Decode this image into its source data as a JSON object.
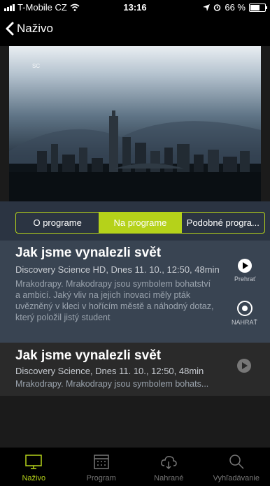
{
  "status": {
    "carrier": "T-Mobile CZ",
    "time": "13:16",
    "battery": "66 %"
  },
  "nav": {
    "back_label": "Naživo"
  },
  "hero": {
    "logo_text": "SC"
  },
  "tabs": [
    {
      "label": "O programe"
    },
    {
      "label": "Na programe"
    },
    {
      "label": "Podobné progra..."
    }
  ],
  "program1": {
    "title": "Jak jsme vynalezli svět",
    "meta": "Discovery Science HD, Dnes 11. 10., 12:50, 48min",
    "description": "Mrakodrapy. Mrakodrapy jsou symbolem bohatství a ambicí. Jaký vliv na jejich inovaci měly pták uvězněný v kleci v hořícím městě a náhodný dotaz, který položil jistý student",
    "play_label": "Prehrať",
    "record_label": "NAHRAŤ"
  },
  "program2": {
    "title": "Jak jsme vynalezli svět",
    "meta": "Discovery Science, Dnes 11. 10., 12:50, 48min",
    "description": "Mrakodrapy. Mrakodrapy jsou symbolem bohats..."
  },
  "tabbar": [
    {
      "label": "Naživo"
    },
    {
      "label": "Program"
    },
    {
      "label": "Nahrané"
    },
    {
      "label": "Vyhľadávanie"
    }
  ],
  "colors": {
    "accent": "#b5d21a"
  }
}
